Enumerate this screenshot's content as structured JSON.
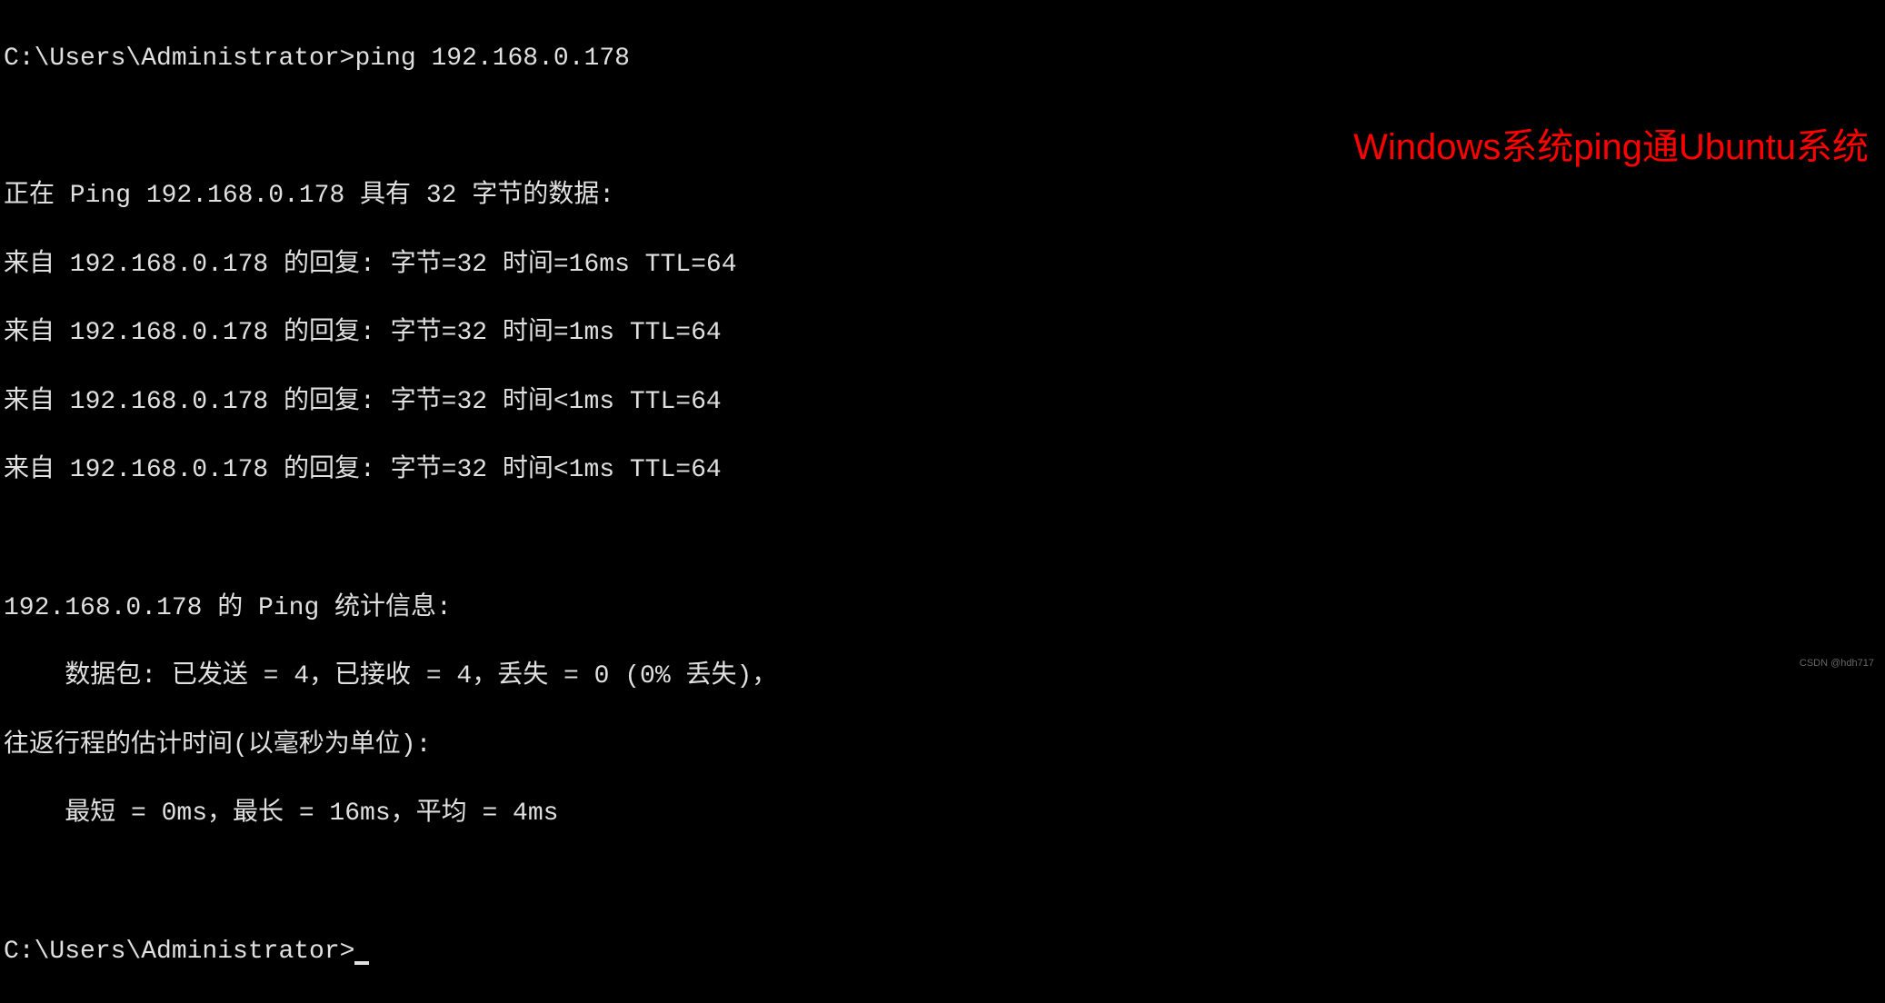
{
  "prompt1": {
    "path": "C:\\Users\\Administrator>",
    "command": "ping 192.168.0.178"
  },
  "output": {
    "blank1": "",
    "header": "正在 Ping 192.168.0.178 具有 32 字节的数据:",
    "reply1": "来自 192.168.0.178 的回复: 字节=32 时间=16ms TTL=64",
    "reply2": "来自 192.168.0.178 的回复: 字节=32 时间=1ms TTL=64",
    "reply3": "来自 192.168.0.178 的回复: 字节=32 时间<1ms TTL=64",
    "reply4": "来自 192.168.0.178 的回复: 字节=32 时间<1ms TTL=64",
    "blank2": "",
    "stats_header": "192.168.0.178 的 Ping 统计信息:",
    "stats_packets": "    数据包: 已发送 = 4，已接收 = 4，丢失 = 0 (0% 丢失)，",
    "stats_trip_header": "往返行程的估计时间(以毫秒为单位):",
    "stats_trip_values": "    最短 = 0ms，最长 = 16ms，平均 = 4ms",
    "blank3": ""
  },
  "prompt2": {
    "path": "C:\\Users\\Administrator>"
  },
  "annotation": "Windows系统ping通Ubuntu系统",
  "watermark": "CSDN @hdh717"
}
